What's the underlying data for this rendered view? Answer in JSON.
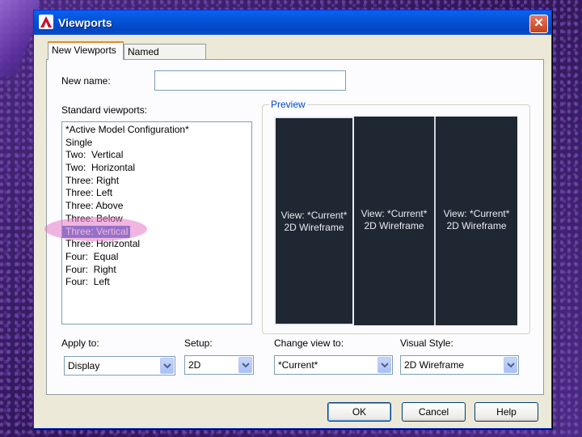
{
  "window": {
    "title": "Viewports"
  },
  "tabs": [
    {
      "label": "New Viewports",
      "active": true
    },
    {
      "label": "Named Viewports",
      "active": false
    }
  ],
  "new_name": {
    "label": "New name:",
    "value": ""
  },
  "standard_viewports": {
    "label": "Standard viewports:",
    "items": [
      "*Active Model Configuration*",
      "Single",
      "Two:  Vertical",
      "Two:  Horizontal",
      "Three: Right",
      "Three: Left",
      "Three: Above",
      "Three: Below",
      "Three: Vertical",
      "Three: Horizontal",
      "Four:  Equal",
      "Four:  Right",
      "Four:  Left"
    ],
    "selected_index": 8
  },
  "preview": {
    "title": "Preview",
    "viewports": [
      {
        "view": "View: *Current*",
        "style": "2D Wireframe"
      },
      {
        "view": "View: *Current*",
        "style": "2D Wireframe"
      },
      {
        "view": "View: *Current*",
        "style": "2D Wireframe"
      }
    ]
  },
  "apply_to": {
    "label": "Apply to:",
    "value": "Display"
  },
  "setup": {
    "label": "Setup:",
    "value": "2D"
  },
  "change_view_to": {
    "label": "Change view to:",
    "value": "*Current*"
  },
  "visual_style": {
    "label": "Visual Style:",
    "value": "2D Wireframe"
  },
  "buttons": {
    "ok": "OK",
    "cancel": "Cancel",
    "help": "Help"
  },
  "colors": {
    "selection": "#316ac5",
    "preview_bg": "#1f2733",
    "titlebar": "#0453d6"
  }
}
